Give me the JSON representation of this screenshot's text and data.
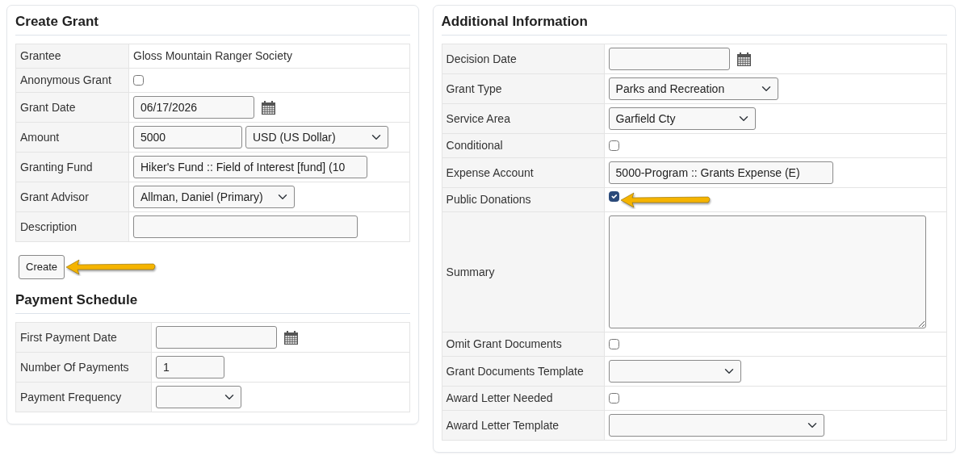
{
  "create_grant": {
    "title": "Create Grant",
    "rows": [
      {
        "label": "Grantee",
        "kind": "text",
        "value": "Gloss Mountain Ranger Society",
        "highlighted": false
      },
      {
        "label": "Anonymous Grant",
        "kind": "checkbox",
        "checked": false,
        "highlighted": false
      },
      {
        "label": "Grant Date",
        "kind": "date",
        "value": "06/17/2026",
        "highlighted": false
      },
      {
        "label": "Amount",
        "kind": "money",
        "value": "5000",
        "currency": "USD (US Dollar)",
        "highlighted": false
      },
      {
        "label": "Granting Fund",
        "kind": "input",
        "value": "Hiker's Fund :: Field of Interest [fund] (10",
        "highlighted": false
      },
      {
        "label": "Grant Advisor",
        "kind": "select",
        "value": "Allman, Daniel (Primary)",
        "highlighted": false
      },
      {
        "label": "Description",
        "kind": "input",
        "highlighted": false
      }
    ],
    "create_button": {
      "label": "Create",
      "highlighted": true
    }
  },
  "payment_schedule": {
    "title": "Payment Schedule",
    "rows": [
      {
        "label": "First Payment Date",
        "kind": "date",
        "highlighted": false
      },
      {
        "label": "Number Of Payments",
        "kind": "input",
        "value": "1",
        "highlighted": false
      },
      {
        "label": "Payment Frequency",
        "kind": "select",
        "highlighted": false
      }
    ]
  },
  "additional_information": {
    "title": "Additional Information",
    "rows": [
      {
        "label": "Decision Date",
        "kind": "date",
        "highlighted": false
      },
      {
        "label": "Grant Type",
        "kind": "select",
        "value": "Parks and Recreation",
        "highlighted": false
      },
      {
        "label": "Service Area",
        "kind": "select",
        "value": "Garfield Cty",
        "highlighted": false
      },
      {
        "label": "Conditional",
        "kind": "checkbox",
        "checked": false,
        "highlighted": false
      },
      {
        "label": "Expense Account",
        "kind": "input",
        "value": "5000-Program :: Grants Expense (E)",
        "highlighted": false
      },
      {
        "label": "Public Donations",
        "kind": "checkbox",
        "checked": true,
        "highlighted": true
      },
      {
        "label": "Summary",
        "kind": "textarea",
        "highlighted": false
      },
      {
        "label": "Omit Grant Documents",
        "kind": "checkbox",
        "checked": false,
        "highlighted": false
      },
      {
        "label": "Grant Documents Template",
        "kind": "select",
        "highlighted": false
      },
      {
        "label": "Award Letter Needed",
        "kind": "checkbox",
        "checked": false,
        "highlighted": false
      },
      {
        "label": "Award Letter Template",
        "kind": "select",
        "highlighted": false
      }
    ]
  }
}
